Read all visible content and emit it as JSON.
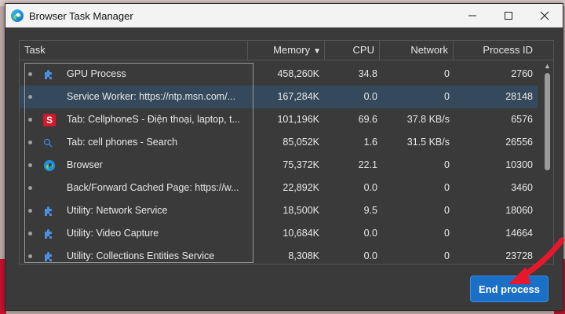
{
  "window": {
    "title": "Browser Task Manager",
    "controls": [
      "minimize-icon",
      "maximize-icon",
      "close-icon"
    ]
  },
  "table": {
    "columns": {
      "task": "Task",
      "memory": "Memory",
      "cpu": "CPU",
      "network": "Network",
      "pid": "Process ID"
    },
    "sort": {
      "column": "memory",
      "direction": "descending"
    },
    "rows": [
      {
        "icon": "puzzle-icon",
        "task": "GPU Process",
        "memory": "458,260K",
        "cpu": "34.8",
        "network": "0",
        "pid": "2760",
        "selected": false
      },
      {
        "icon": "",
        "task": "Service Worker: https://ntp.msn.com/...",
        "memory": "167,284K",
        "cpu": "0.0",
        "network": "0",
        "pid": "28148",
        "selected": true
      },
      {
        "icon": "cellphones-icon",
        "task": "Tab: CellphoneS - Điện thoại, laptop, t...",
        "memory": "101,196K",
        "cpu": "69.6",
        "network": "37.8 KB/s",
        "pid": "6576",
        "selected": false
      },
      {
        "icon": "search-icon",
        "task": "Tab: cell phones - Search",
        "memory": "85,052K",
        "cpu": "1.6",
        "network": "31.5 KB/s",
        "pid": "26556",
        "selected": false
      },
      {
        "icon": "edge-icon",
        "task": "Browser",
        "memory": "75,372K",
        "cpu": "22.1",
        "network": "0",
        "pid": "10300",
        "selected": false
      },
      {
        "icon": "",
        "task": "Back/Forward Cached Page: https://w...",
        "memory": "22,892K",
        "cpu": "0.0",
        "network": "0",
        "pid": "3460",
        "selected": false
      },
      {
        "icon": "puzzle-icon",
        "task": "Utility: Network Service",
        "memory": "18,500K",
        "cpu": "9.5",
        "network": "0",
        "pid": "18060",
        "selected": false
      },
      {
        "icon": "puzzle-icon",
        "task": "Utility: Video Capture",
        "memory": "10,684K",
        "cpu": "0.0",
        "network": "0",
        "pid": "14664",
        "selected": false
      },
      {
        "icon": "puzzle-icon",
        "task": "Utility: Collections Entities Service",
        "memory": "8,308K",
        "cpu": "0.0",
        "network": "0",
        "pid": "23728",
        "selected": false
      }
    ]
  },
  "actions": {
    "end_process": "End process"
  },
  "colors": {
    "accent": "#1a6fc6",
    "selected_row": "#344a5c",
    "annotation_arrow": "#e8182c"
  }
}
